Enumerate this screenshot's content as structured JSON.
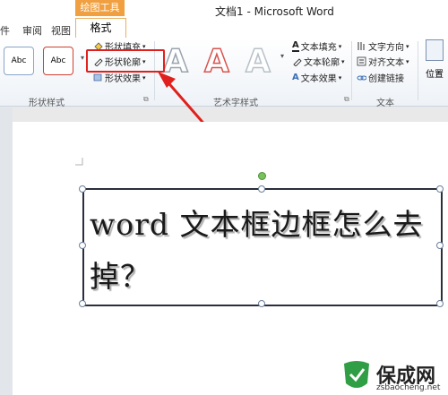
{
  "window": {
    "title": "文档1 - Microsoft Word"
  },
  "ribbon": {
    "tool_group": "绘图工具",
    "tabs": [
      "件",
      "审阅",
      "视图"
    ],
    "active_tab": "格式",
    "shape_styles": {
      "samples": [
        "Abc",
        "Abc"
      ],
      "fill": "形状填充",
      "outline": "形状轮廓",
      "effects": "形状效果",
      "label": "形状样式"
    },
    "wordart": {
      "samples": [
        "A",
        "A",
        "A"
      ],
      "text_fill": "文本填充",
      "text_outline": "文本轮廓",
      "text_effects": "文本效果",
      "label": "艺术字样式"
    },
    "text": {
      "direction": "文字方向",
      "align": "对齐文本",
      "link": "创建链接",
      "label": "文本"
    },
    "position": "位置"
  },
  "document": {
    "textbox_text": "word 文本框边框怎么去掉？"
  },
  "watermark": {
    "name": "保成网",
    "url": "zsbaocheng.net"
  },
  "colors": {
    "highlight": "#e0201c",
    "tool_group": "#f0a040"
  }
}
